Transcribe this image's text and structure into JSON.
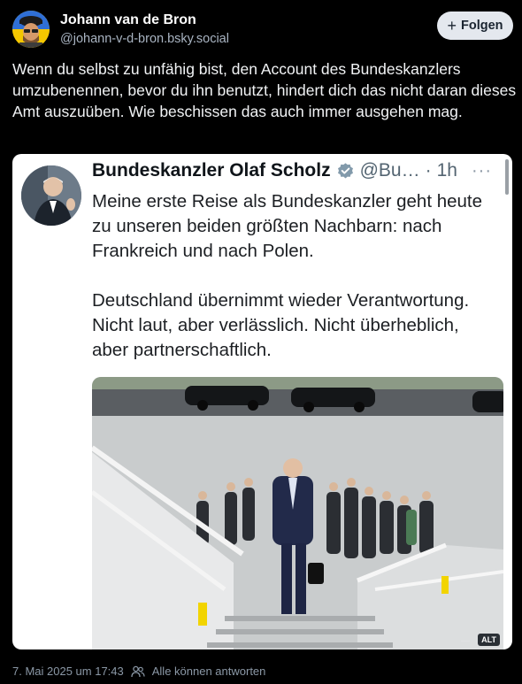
{
  "post": {
    "author_name": "Johann van de Bron",
    "author_handle": "@johann-v-d-bron.bsky.social",
    "follow_label": "Folgen",
    "follow_icon": "+",
    "text": "Wenn du selbst zu unfähig bist, den Account des Bundeskanzlers umzubenennen, bevor du ihn benutzt, hindert dich das nicht daran dieses Amt auszuüben. Wie beschissen das auch immer ausgehen mag.",
    "timestamp": "7. Mai 2025 um 17:43",
    "reply_setting": "Alle können antworten"
  },
  "embed": {
    "name": "Bundeskanzler Olaf Scholz",
    "handle": "@Bu…",
    "separator": "·",
    "time": "1h",
    "more": "···",
    "paragraphs": [
      "Meine erste Reise als Bundeskanzler geht heute zu unseren beiden größten Nachbarn: nach Frankreich und nach Polen.",
      "Deutschland übernimmt wieder Verantwortung. Nicht laut, aber verlässlich. Nicht überheblich, aber partnerschaftlich."
    ],
    "alt_badge": "ALT"
  },
  "icons": {
    "verified": "verified-badge-icon",
    "follow": "plus-icon",
    "reply_setting": "people-icon"
  },
  "colors": {
    "background": "#000000",
    "embed_background": "#ffffff",
    "verified_badge": "#829aab",
    "follow_button": "#e4e8ee"
  }
}
